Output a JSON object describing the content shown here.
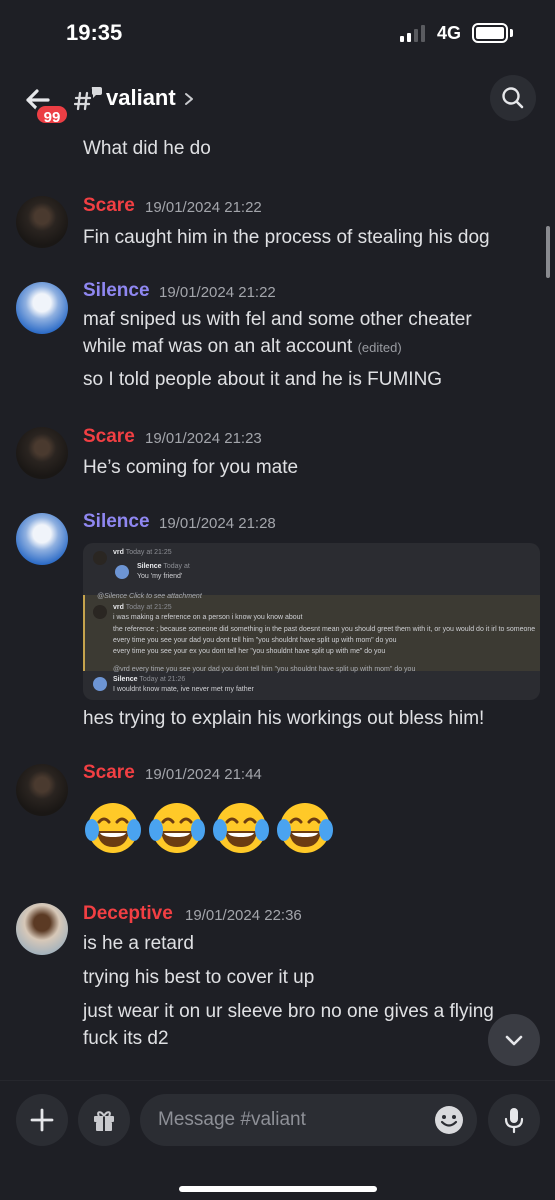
{
  "status_bar": {
    "time": "19:35",
    "network": "4G"
  },
  "header": {
    "badge_count": "99",
    "channel_name": "valiant"
  },
  "messages": {
    "partial": {
      "text": "What did he do"
    },
    "m1": {
      "author": "Scare",
      "author_color": "#f23f43",
      "time": "19/01/2024 21:22",
      "lines": [
        "Fin caught him in the process of stealing his dog"
      ]
    },
    "m2": {
      "author": "Silence",
      "author_color": "#8f87f1",
      "time": "19/01/2024 21:22",
      "lines": [
        "maf sniped us with fel and some other cheater",
        "while maf was on an alt account",
        "so I told people about it and he is FUMING"
      ],
      "edited": "(edited)"
    },
    "m3": {
      "author": "Scare",
      "author_color": "#f23f43",
      "time": "19/01/2024 21:23",
      "lines": [
        "He’s coming for you mate"
      ]
    },
    "m4": {
      "author": "Silence",
      "author_color": "#8f87f1",
      "time": "19/01/2024 21:28",
      "attachment": {
        "l1_name": "vrd",
        "l1_time": "Today at 21:25",
        "l2_name": "Silence",
        "l2_time": "Today at",
        "l2_text": "You 'my friend'",
        "reply_ref": "@Silence Click to see attachment",
        "l3_name": "vrd",
        "l3_time": "Today at 21:25",
        "l3_lines": [
          "i was making a reference on a person i know you know about",
          "the reference ; because someone did something in the past doesnt mean you should greet them with it, or you would do it irl to someone",
          "every time you see your dad you dont tell him \"you shouldnt have split up with mom\" do you",
          "every time you see your ex you dont tell her \"you shouldnt have split up with me\" do you"
        ],
        "reply2": "@vrd every time you see your dad you dont tell him \"you shouldnt have split up with mom\" do you",
        "l4_name": "Silence",
        "l4_time": "Today at 21:26",
        "l4_text": "I wouldnt know mate, ive never met my father"
      },
      "lines": [
        "hes trying to explain his workings out bless him!"
      ]
    },
    "m5": {
      "author": "Scare",
      "author_color": "#f23f43",
      "time": "19/01/2024 21:44",
      "emoji": [
        "😂",
        "😂",
        "😂",
        "😂"
      ]
    },
    "m6": {
      "author": "Deceptive",
      "author_color": "#f23f43",
      "time": "19/01/2024 22:36",
      "lines": [
        "is he a retard",
        "trying his best to cover it up",
        "just wear it on ur sleeve bro no one gives a flying",
        "fuck its d2"
      ]
    }
  },
  "composer": {
    "placeholder": "Message #valiant"
  },
  "icons": [
    "back-arrow-icon",
    "channel-thread-icon",
    "search-icon",
    "plus-icon",
    "gift-icon",
    "emoji-icon",
    "microphone-icon",
    "chevron-down-icon"
  ]
}
